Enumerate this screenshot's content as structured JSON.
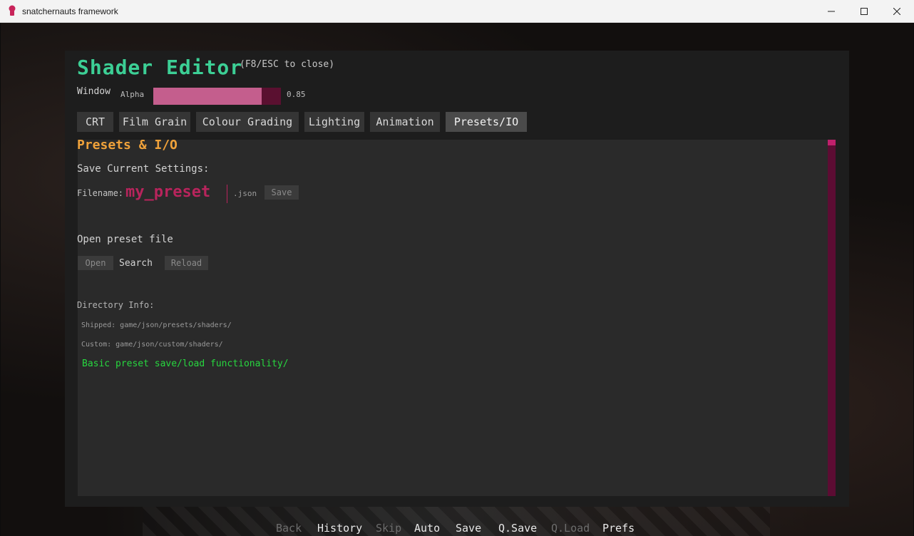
{
  "window": {
    "title": "snatchernauts framework",
    "icon": "app-icon"
  },
  "editor": {
    "title": "Shader Editor",
    "hint": "(F8/ESC to close)",
    "window_label": "Window",
    "alpha_label": "Alpha",
    "alpha_value": "0.85",
    "alpha_level": 0.85,
    "tabs": [
      {
        "label": "CRT",
        "active": false
      },
      {
        "label": "Film Grain",
        "active": false
      },
      {
        "label": "Colour Grading",
        "active": false
      },
      {
        "label": "Lighting",
        "active": false
      },
      {
        "label": "Animation",
        "active": false
      },
      {
        "label": "Presets/IO",
        "active": true
      }
    ]
  },
  "presets": {
    "section_title": "Presets & I/O",
    "save_heading": "Save Current Settings:",
    "filename_label": "Filename:",
    "filename_value": "my_preset",
    "extension": ".json",
    "save_button": "Save",
    "open_heading": "Open preset file",
    "open_button": "Open",
    "search_label": "Search",
    "reload_button": "Reload",
    "dir_heading": "Directory Info:",
    "shipped_path": "Shipped: game/json/presets/shaders/",
    "custom_path": "Custom: game/json/custom/shaders/",
    "status_message": "Basic preset save/load functionality/"
  },
  "quick_menu": [
    {
      "label": "Back",
      "enabled": false
    },
    {
      "label": "History",
      "enabled": true
    },
    {
      "label": "Skip",
      "enabled": false
    },
    {
      "label": "Auto",
      "enabled": true
    },
    {
      "label": "Save",
      "enabled": true
    },
    {
      "label": "Q.Save",
      "enabled": true
    },
    {
      "label": "Q.Load",
      "enabled": false
    },
    {
      "label": "Prefs",
      "enabled": true
    }
  ],
  "colors": {
    "title_green": "#3ccf95",
    "section_orange": "#f0a23a",
    "accent_pink": "#c45e8d",
    "filename_magenta": "#b8245c",
    "status_green": "#27d63f"
  }
}
